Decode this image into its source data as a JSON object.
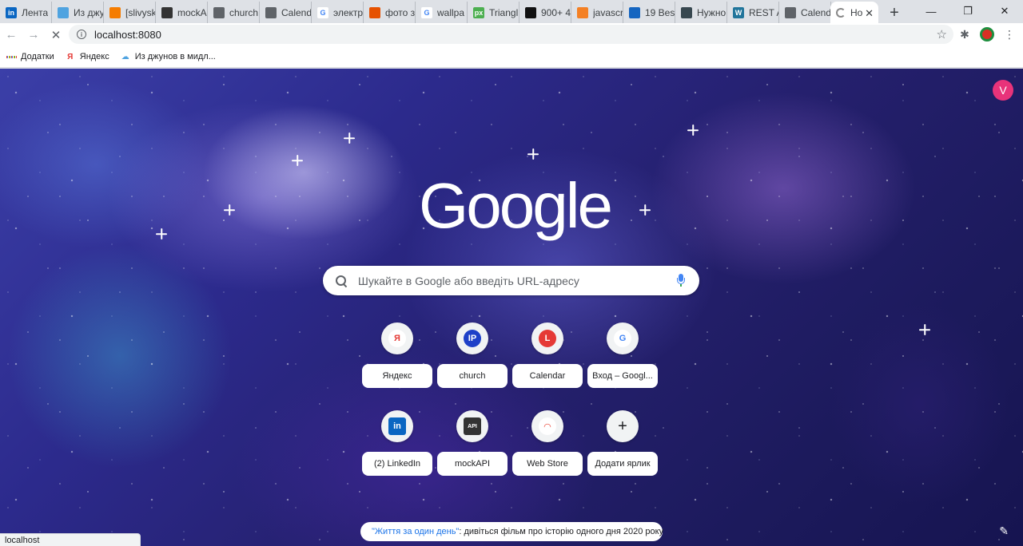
{
  "tabs": [
    {
      "title": "Лента",
      "icon": "linkedin-icon",
      "color": "#0a66c2",
      "glyph": "in"
    },
    {
      "title": "Из джу",
      "icon": "cloud-icon",
      "color": "#4fa3e0",
      "glyph": ""
    },
    {
      "title": "[slivysk",
      "icon": "orange-icon",
      "color": "#f57c00",
      "glyph": ""
    },
    {
      "title": "mockA",
      "icon": "mockapi-icon",
      "color": "#333333",
      "glyph": ""
    },
    {
      "title": "church",
      "icon": "globe-icon",
      "color": "#5f6368",
      "glyph": ""
    },
    {
      "title": "Calend",
      "icon": "globe-icon",
      "color": "#5f6368",
      "glyph": ""
    },
    {
      "title": "электр",
      "icon": "google-icon",
      "color": "#ffffff",
      "glyph": "G"
    },
    {
      "title": "фото з",
      "icon": "sun-icon",
      "color": "#e65100",
      "glyph": ""
    },
    {
      "title": "wallpa",
      "icon": "google-icon",
      "color": "#ffffff",
      "glyph": "G"
    },
    {
      "title": "Triangl",
      "icon": "px-icon",
      "color": "#4caf50",
      "glyph": "px"
    },
    {
      "title": "900+ 4",
      "icon": "unsplash-icon",
      "color": "#111111",
      "glyph": ""
    },
    {
      "title": "javascr",
      "icon": "stack-icon",
      "color": "#f48024",
      "glyph": ""
    },
    {
      "title": "19 Bes",
      "icon": "owl-icon",
      "color": "#1565c0",
      "glyph": ""
    },
    {
      "title": "Нужно",
      "icon": "square-icon",
      "color": "#37474f",
      "glyph": ""
    },
    {
      "title": "REST A",
      "icon": "wordpress-icon",
      "color": "#21759b",
      "glyph": "W"
    },
    {
      "title": "Calend",
      "icon": "globe-icon",
      "color": "#5f6368",
      "glyph": ""
    }
  ],
  "active_tab": {
    "title": "Но",
    "close": "✕"
  },
  "new_tab": "+",
  "window_controls": {
    "minimize": "—",
    "maximize": "❐",
    "close": "✕"
  },
  "toolbar": {
    "back": "←",
    "forward": "→",
    "stop": "✕",
    "url": "localhost:8080",
    "info": "i",
    "star": "☆"
  },
  "bookmarks": [
    {
      "label": "Додатки",
      "icon": "apps-icon"
    },
    {
      "label": "Яндекс",
      "icon": "yandex-icon",
      "glyph": "Я"
    },
    {
      "label": "Из джунов в мидл...",
      "icon": "cloud-icon"
    }
  ],
  "content": {
    "avatar_letter": "V",
    "logo_text": "Google",
    "search_placeholder": "Шукайте в Google або введіть URL-адресу",
    "shortcuts": [
      {
        "label": "Яндекс",
        "icon": "yandex-icon",
        "glyph": "Я",
        "bg": "#ffffff",
        "fg": "#e53935"
      },
      {
        "label": "church",
        "icon": "ip-icon",
        "glyph": "IP",
        "bg": "#1e40c8",
        "fg": "#ffffff"
      },
      {
        "label": "Calendar",
        "icon": "calendar-icon",
        "glyph": "L",
        "bg": "#e53935",
        "fg": "#ffffff"
      },
      {
        "label": "Вход – Googl...",
        "icon": "google-icon",
        "glyph": "G",
        "bg": "#ffffff",
        "fg": "#4285f4"
      },
      {
        "label": "(2) LinkedIn",
        "icon": "linkedin-icon",
        "glyph": "in",
        "bg": "#0a66c2",
        "fg": "#ffffff"
      },
      {
        "label": "mockAPI",
        "icon": "mockapi-icon",
        "glyph": "API",
        "bg": "#333333",
        "fg": "#ffffff"
      },
      {
        "label": "Web Store",
        "icon": "webstore-icon",
        "glyph": "◠",
        "bg": "#ffffff",
        "fg": "#ea4335"
      },
      {
        "label": "Додати ярлик",
        "icon": "add-icon",
        "glyph": "+",
        "bg": "#f1f3f4",
        "fg": "#202124"
      }
    ],
    "promo": {
      "link": "\"Життя за один день\"",
      "text": ": дивіться фільм про історію одного дня 2020 року"
    },
    "status_url": "localhost"
  }
}
